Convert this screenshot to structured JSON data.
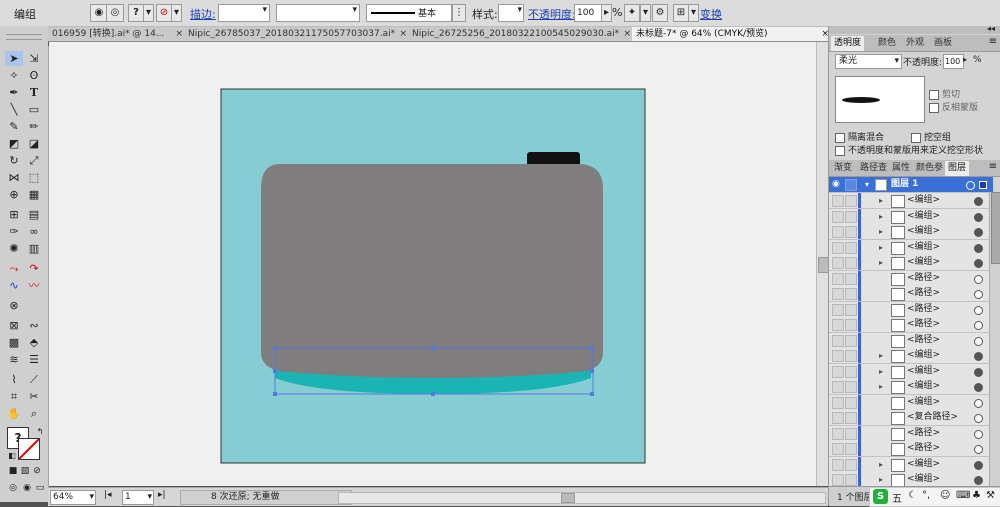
{
  "control_bar": {
    "object_type": "编组",
    "stroke_label": "描边:",
    "stroke_value": "",
    "brush_value": "",
    "brush_style": "基本",
    "style_label": "样式:",
    "opacity_label": "不透明度:",
    "opacity_value": "100",
    "opacity_unit": "%",
    "transform_label": "变换"
  },
  "document_tabs": [
    {
      "label": "016959 [转换].ai* @ 14...",
      "active": false
    },
    {
      "label": "Nipic_26785037_20180321175057703037.ai*",
      "active": false
    },
    {
      "label": "Nipic_26725256_20180322100545029030.ai*",
      "active": false
    },
    {
      "label": "未标题-7* @ 64% (CMYK/预览)",
      "active": true
    }
  ],
  "canvas": {
    "background_color": "#86cdd3",
    "camera_body_color": "#807d7f",
    "camera_base_color": "#1bb4b5",
    "shutter_color": "#111111",
    "selection_color": "#5577e0"
  },
  "status_bar": {
    "zoom": "64%",
    "page": "1",
    "undo_info": "8 次还原; 无重做"
  },
  "transparency_panel": {
    "tabs": [
      "透明度",
      "颜色",
      "外观",
      "画板"
    ],
    "blend_mode": "柔光",
    "opacity_label": "不透明度:",
    "opacity_value": "100",
    "opacity_unit": "%",
    "clip_label": "剪切",
    "invert_mask_label": "反相蒙版",
    "isolate_blending_label": "隔离混合",
    "knockout_group_label": "挖空组",
    "opacity_mask_label": "不透明度和蒙版用来定义挖空形状"
  },
  "layers_panel": {
    "tabs": [
      "渐变",
      "路径查",
      "属性",
      "颜色参",
      "图层"
    ],
    "layer_name": "图层 1",
    "rows": [
      {
        "name": "<编组>",
        "expandable": true,
        "filled": true
      },
      {
        "name": "<编组>",
        "expandable": true,
        "filled": true
      },
      {
        "name": "<编组>",
        "expandable": true,
        "filled": true
      },
      {
        "name": "<编组>",
        "expandable": true,
        "filled": true
      },
      {
        "name": "<编组>",
        "expandable": true,
        "filled": true
      },
      {
        "name": "<路径>",
        "expandable": false,
        "filled": false
      },
      {
        "name": "<路径>",
        "expandable": false,
        "filled": false
      },
      {
        "name": "<路径>",
        "expandable": false,
        "filled": false
      },
      {
        "name": "<路径>",
        "expandable": false,
        "filled": false
      },
      {
        "name": "<路径>",
        "expandable": false,
        "filled": false
      },
      {
        "name": "<编组>",
        "expandable": true,
        "filled": true
      },
      {
        "name": "<编组>",
        "expandable": true,
        "filled": true
      },
      {
        "name": "<编组>",
        "expandable": true,
        "filled": true
      },
      {
        "name": "<编组>",
        "expandable": false,
        "filled": false
      },
      {
        "name": "<复合路径>",
        "expandable": false,
        "filled": false
      },
      {
        "name": "<路径>",
        "expandable": false,
        "filled": false
      },
      {
        "name": "<路径>",
        "expandable": false,
        "filled": false
      },
      {
        "name": "<编组>",
        "expandable": true,
        "filled": true
      },
      {
        "name": "<编组>",
        "expandable": true,
        "filled": true
      }
    ],
    "footer": "1 个图层"
  },
  "taskbar": {
    "ime_label": "五"
  }
}
